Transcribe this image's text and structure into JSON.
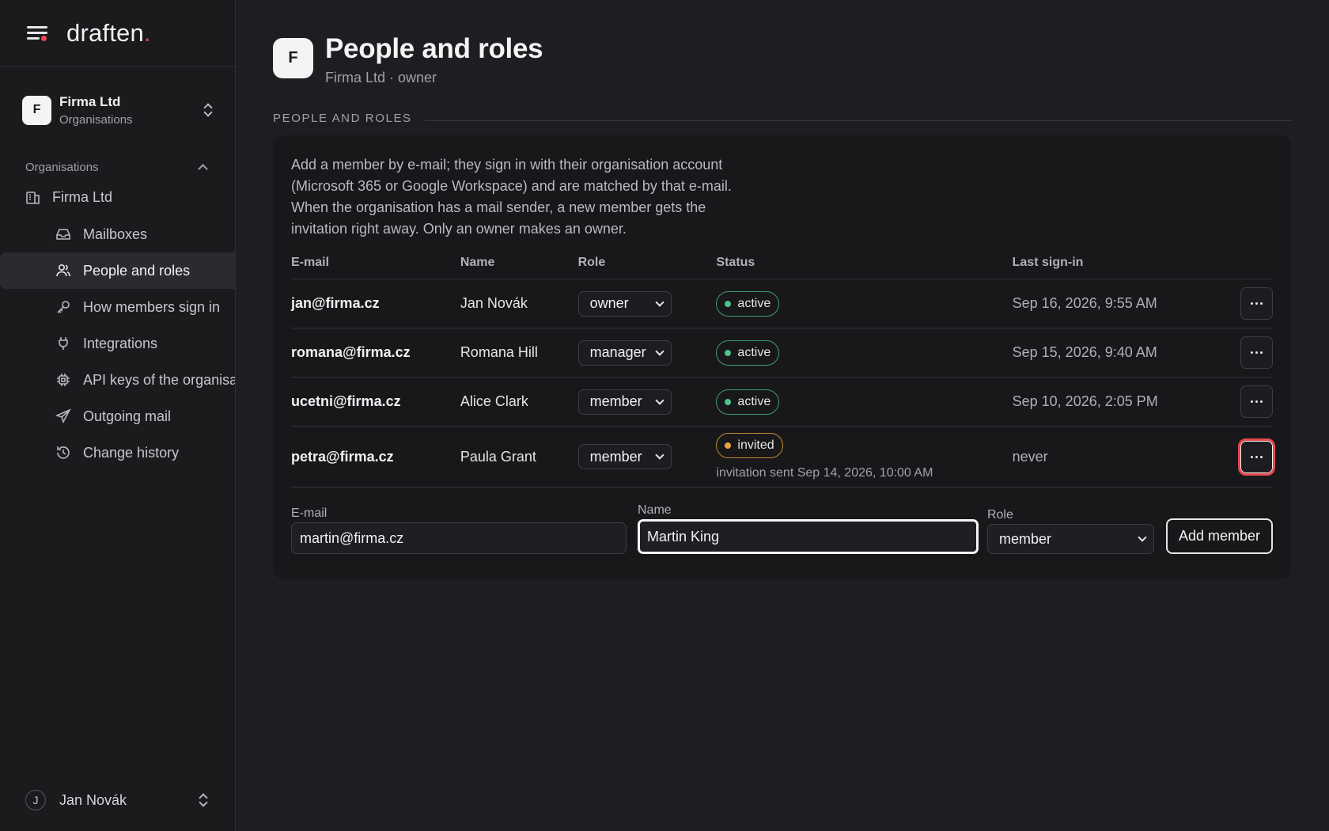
{
  "brand": {
    "name": "draften",
    "dot": "."
  },
  "org_switcher": {
    "initial": "F",
    "name": "Firma Ltd",
    "subtitle": "Organisations"
  },
  "sidebar": {
    "section_title": "Organisations",
    "org_item": "Firma Ltd",
    "items": [
      {
        "label": "Mailboxes",
        "icon": "inbox-icon"
      },
      {
        "label": "People and roles",
        "icon": "users-icon",
        "active": true
      },
      {
        "label": "How members sign in",
        "icon": "key-icon"
      },
      {
        "label": "Integrations",
        "icon": "plug-icon"
      },
      {
        "label": "API keys of the organisation",
        "icon": "chip-icon"
      },
      {
        "label": "Outgoing mail",
        "icon": "send-icon"
      },
      {
        "label": "Change history",
        "icon": "history-icon"
      }
    ]
  },
  "user": {
    "initial": "J",
    "name": "Jan Novák"
  },
  "header": {
    "initial": "F",
    "title": "People and roles",
    "subtitle": "Firma Ltd · owner"
  },
  "section_label": "PEOPLE AND ROLES",
  "intro": "Add a member by e-mail; they sign in with their organisation account (Microsoft 365 or Google Workspace) and are matched by that e-mail. When the organisation has a mail sender, a new member gets the invitation right away. Only an owner makes an owner.",
  "table": {
    "columns": [
      "E-mail",
      "Name",
      "Role",
      "Status",
      "Last sign-in"
    ],
    "rows": [
      {
        "email": "jan@firma.cz",
        "name": "Jan Novák",
        "role": "owner",
        "status": "active",
        "last": "Sep 16, 2026, 9:55 AM"
      },
      {
        "email": "romana@firma.cz",
        "name": "Romana Hill",
        "role": "manager",
        "status": "active",
        "last": "Sep 15, 2026, 9:40 AM"
      },
      {
        "email": "ucetni@firma.cz",
        "name": "Alice Clark",
        "role": "member",
        "status": "active",
        "last": "Sep 10, 2026, 2:05 PM"
      },
      {
        "email": "petra@firma.cz",
        "name": "Paula Grant",
        "role": "member",
        "status": "invited",
        "note": "invitation sent Sep 14, 2026, 10:00 AM",
        "last": "never"
      }
    ]
  },
  "add_form": {
    "email_label": "E-mail",
    "email_value": "martin@firma.cz",
    "name_label": "Name",
    "name_value": "Martin King",
    "role_label": "Role",
    "role_value": "member",
    "submit_label": "Add member"
  },
  "colors": {
    "accent": "#e5484d",
    "active": "#4cc38a",
    "invited": "#e6a23c",
    "background": "#1e1e22"
  }
}
